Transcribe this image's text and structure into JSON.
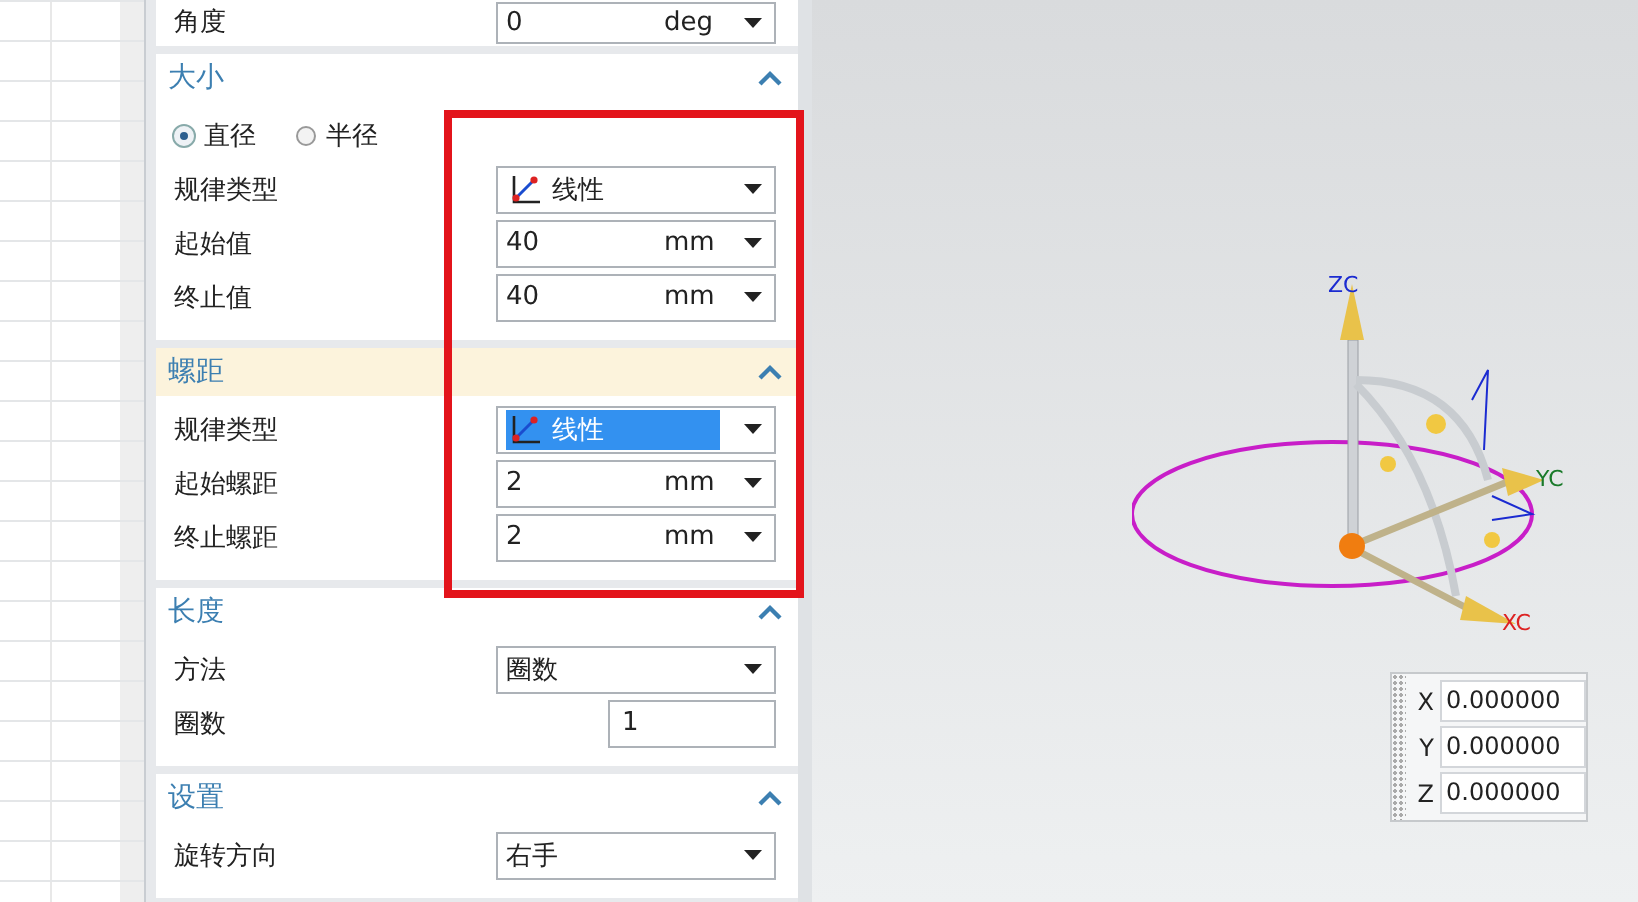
{
  "panel": {
    "sections": [
      {
        "rows": [
          {
            "kind": "dropdown",
            "label": "角度",
            "value": "0",
            "unit": "deg"
          }
        ]
      },
      {
        "title": "大小",
        "expanded": true,
        "selected": false,
        "rows": [
          {
            "kind": "radio",
            "options": [
              {
                "label": "直径",
                "selected": true
              },
              {
                "label": "半径",
                "selected": false
              }
            ]
          },
          {
            "kind": "law",
            "label": "规律类型",
            "value": "线性",
            "selected": false
          },
          {
            "kind": "dropdown",
            "label": "起始值",
            "value": "40",
            "unit": "mm"
          },
          {
            "kind": "dropdown",
            "label": "终止值",
            "value": "40",
            "unit": "mm"
          }
        ]
      },
      {
        "title": "螺距",
        "expanded": true,
        "selected": true,
        "rows": [
          {
            "kind": "law",
            "label": "规律类型",
            "value": "线性",
            "selected": true
          },
          {
            "kind": "dropdown",
            "label": "起始螺距",
            "value": "2",
            "unit": "mm"
          },
          {
            "kind": "dropdown",
            "label": "终止螺距",
            "value": "2",
            "unit": "mm"
          }
        ]
      },
      {
        "title": "长度",
        "expanded": true,
        "selected": false,
        "rows": [
          {
            "kind": "dropdown",
            "label": "方法",
            "value": "圈数"
          },
          {
            "kind": "number",
            "label": "圈数",
            "value": "1"
          }
        ]
      },
      {
        "title": "设置",
        "expanded": true,
        "selected": false,
        "rows": [
          {
            "kind": "dropdown",
            "label": "旋转方向",
            "value": "右手"
          }
        ]
      }
    ]
  },
  "viewport": {
    "axes": {
      "z": "ZC",
      "y": "YC",
      "x": "XC"
    },
    "coord_box": [
      {
        "axis": "X",
        "value": "0.000000"
      },
      {
        "axis": "Y",
        "value": "0.000000"
      },
      {
        "axis": "Z",
        "value": "0.000000"
      }
    ]
  }
}
